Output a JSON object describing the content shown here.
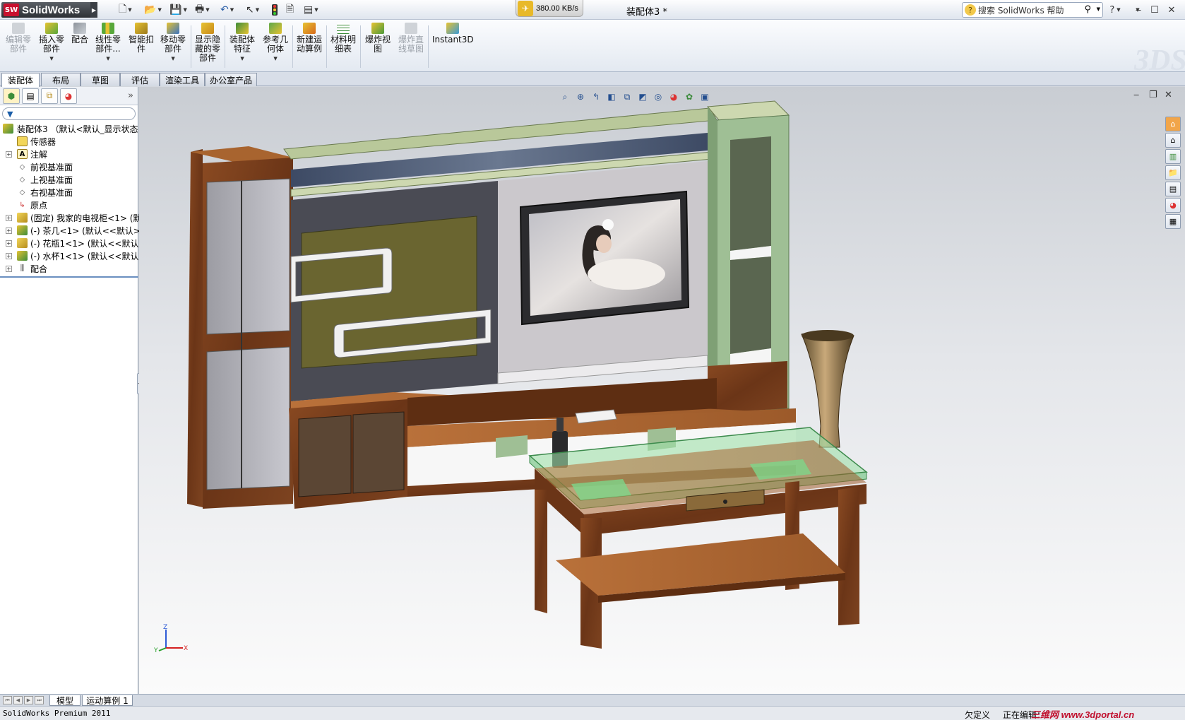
{
  "titlebar": {
    "app_name": "SolidWorks",
    "app_logo_text": "SW",
    "speed": "380.00 KB/s",
    "doc_title": "装配体3 *",
    "search_placeholder": "搜索 SolidWorks 帮助",
    "help": "?"
  },
  "command_manager": {
    "items": [
      {
        "label": "编辑零\n部件",
        "disabled": true
      },
      {
        "label": "插入零\n部件"
      },
      {
        "label": "配合"
      },
      {
        "label": "线性零\n部件..."
      },
      {
        "label": "智能扣\n件"
      },
      {
        "label": "移动零\n部件"
      },
      {
        "label": "显示隐\n藏的零\n部件"
      },
      {
        "label": "装配体\n特征"
      },
      {
        "label": "参考几\n何体"
      },
      {
        "label": "新建运\n动算例"
      },
      {
        "label": "材料明\n细表"
      },
      {
        "label": "爆炸视\n图"
      },
      {
        "label": "爆炸直\n线草图",
        "disabled": true
      },
      {
        "label": "Instant3D"
      }
    ]
  },
  "tabs": [
    "装配体",
    "布局",
    "草图",
    "评估",
    "渲染工具",
    "办公室产品"
  ],
  "feature_tree": {
    "root": "装配体3 （默认<默认_显示状态",
    "items": [
      {
        "label": "传感器"
      },
      {
        "label": "注解"
      },
      {
        "label": "前视基准面"
      },
      {
        "label": "上视基准面"
      },
      {
        "label": "右视基准面"
      },
      {
        "label": "原点"
      },
      {
        "label": "(固定) 我家的电视柜<1> (默"
      },
      {
        "label": "(-) 茶几<1> (默认<<默认>_"
      },
      {
        "label": "(-) 花瓶1<1> (默认<<默认>_"
      },
      {
        "label": "(-) 水杯1<1> (默认<<默认>_"
      },
      {
        "label": "配合"
      }
    ]
  },
  "triad": {
    "x": "X",
    "y": "Y",
    "z": "Z"
  },
  "bottom_tabs": [
    "模型",
    "运动算例 1"
  ],
  "status": {
    "product": "SolidWorks Premium 2011",
    "state": "欠定义",
    "editing": "正在编辑：",
    "watermark": "三维网 www.3dportal.cn"
  },
  "colors": {
    "wood": "#7a3f1c",
    "panel_green": "#9fbf95",
    "glass": "#9fe0a8"
  }
}
